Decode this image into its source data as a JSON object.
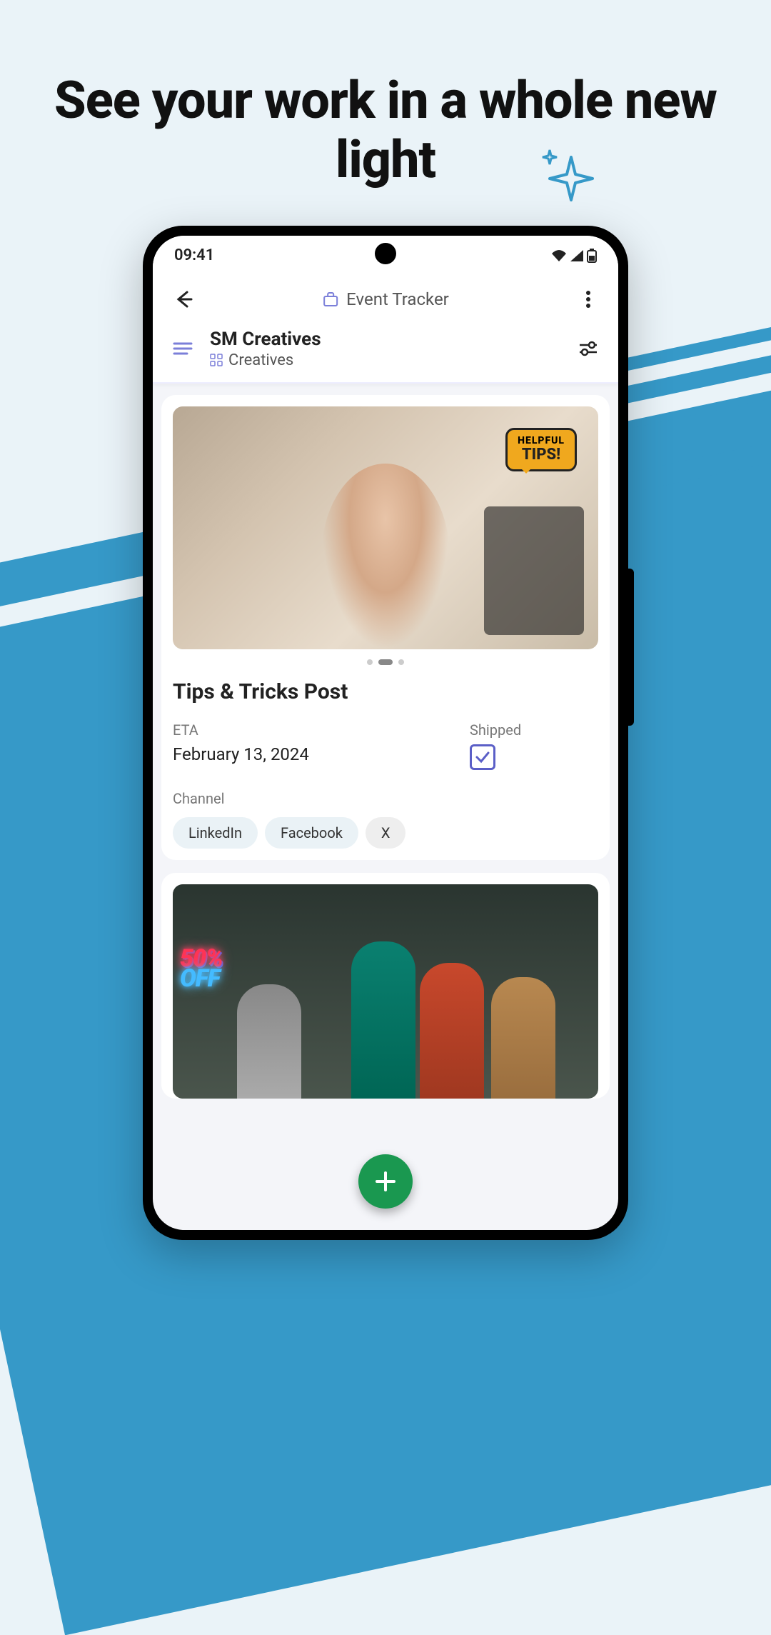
{
  "headline": "See your work in a whole new light",
  "statusbar": {
    "time": "09:41"
  },
  "appbar": {
    "title": "Event Tracker"
  },
  "subheader": {
    "title": "SM Creatives",
    "subtitle": "Creatives"
  },
  "card1": {
    "badge_small": "HELPFUL",
    "badge_big": "TIPS!",
    "title": "Tips & Tricks Post",
    "eta_label": "ETA",
    "eta_value": "February 13, 2024",
    "shipped_label": "Shipped",
    "shipped": true,
    "channel_label": "Channel",
    "channels": [
      "LinkedIn",
      "Facebook",
      "X"
    ]
  },
  "card2": {
    "neon_pct": "50%",
    "neon_off": "OFF"
  },
  "fab": {
    "label": "+"
  }
}
